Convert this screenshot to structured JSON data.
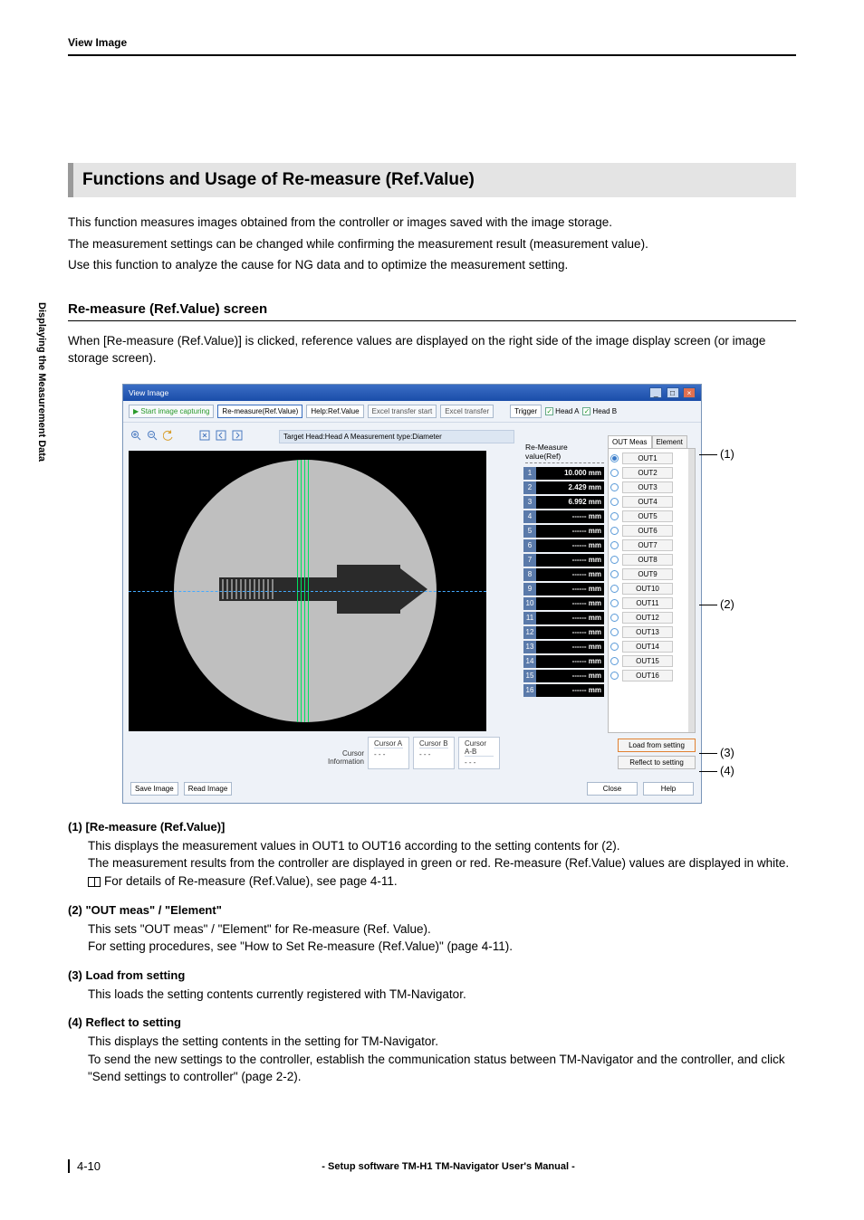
{
  "header": {
    "title": "View Image"
  },
  "sideTab": "Displaying the Measurement Data",
  "section": {
    "title": "Functions and Usage of Re-measure (Ref.Value)"
  },
  "intro": [
    "This function measures images obtained from the controller or images saved with the image storage.",
    "The measurement settings can be changed while confirming the measurement result (measurement value).",
    "Use this function to analyze the cause for NG data and to optimize the measurement setting."
  ],
  "subhead": "Re-measure (Ref.Value) screen",
  "subpara": "When [Re-measure (Ref.Value)] is clicked, reference values are displayed on the right side of the image display screen (or image storage screen).",
  "window": {
    "title": "View Image",
    "toolbar": {
      "start": "Start image capturing",
      "remeasure": "Re-measure(Ref.Value)",
      "help": "Help:Ref.Value",
      "xfer_start": "Excel transfer start",
      "xfer": "Excel transfer",
      "trigger": "Trigger",
      "headA": "Head A",
      "headB": "Head B"
    },
    "infobar": "Target Head:Head A  Measurement type:Diameter",
    "valHeader": "Re-Measure value(Ref)",
    "values": [
      {
        "i": "1",
        "v": "10.000 mm"
      },
      {
        "i": "2",
        "v": "2.429 mm"
      },
      {
        "i": "3",
        "v": "6.992 mm"
      },
      {
        "i": "4",
        "v": "------ mm"
      },
      {
        "i": "5",
        "v": "------ mm"
      },
      {
        "i": "6",
        "v": "------ mm"
      },
      {
        "i": "7",
        "v": "------ mm"
      },
      {
        "i": "8",
        "v": "------ mm"
      },
      {
        "i": "9",
        "v": "------ mm"
      },
      {
        "i": "10",
        "v": "------ mm"
      },
      {
        "i": "11",
        "v": "------ mm"
      },
      {
        "i": "12",
        "v": "------ mm"
      },
      {
        "i": "13",
        "v": "------ mm"
      },
      {
        "i": "14",
        "v": "------ mm"
      },
      {
        "i": "15",
        "v": "------ mm"
      },
      {
        "i": "16",
        "v": "------ mm"
      }
    ],
    "tabs": {
      "a": "OUT Meas",
      "b": "Element"
    },
    "outs": [
      "OUT1",
      "OUT2",
      "OUT3",
      "OUT4",
      "OUT5",
      "OUT6",
      "OUT7",
      "OUT8",
      "OUT9",
      "OUT10",
      "OUT11",
      "OUT12",
      "OUT13",
      "OUT14",
      "OUT15",
      "OUT16"
    ],
    "load": "Load from setting",
    "reflect": "Reflect to setting",
    "cursor": {
      "label": "Cursor\nInformation",
      "a": "Cursor A",
      "b": "Cursor B",
      "ab": "Cursor A-B",
      "dash": "- - -"
    },
    "footer": {
      "save": "Save Image",
      "read": "Read Image",
      "close": "Close",
      "helpb": "Help"
    }
  },
  "callouts": {
    "c1": "(1)",
    "c2": "(2)",
    "c3": "(3)",
    "c4": "(4)"
  },
  "items": [
    {
      "head": "(1) [Re-measure (Ref.Value)]",
      "lines": [
        "This displays the measurement values in OUT1 to OUT16 according to the setting contents for (2).",
        "The measurement results from the controller are displayed in green or red. Re-measure (Ref.Value) values are displayed in white."
      ],
      "ref": "For details of Re-measure (Ref.Value), see page 4-11."
    },
    {
      "head": "(2) \"OUT meas\" / \"Element\"",
      "lines": [
        "This sets \"OUT meas\" / \"Element\" for Re-measure (Ref. Value).",
        "For setting procedures, see \"How to Set Re-measure (Ref.Value)\" (page 4-11)."
      ]
    },
    {
      "head": "(3) Load from setting",
      "lines": [
        "This loads the setting contents currently registered with TM-Navigator."
      ]
    },
    {
      "head": "(4) Reflect to setting",
      "lines": [
        "This displays the setting contents in the setting for TM-Navigator.",
        "To send the new settings to the controller, establish the communication status between TM-Navigator and the controller, and click \"Send settings to controller\" (page 2-2)."
      ]
    }
  ],
  "footer": {
    "page": "4-10",
    "manual": "- Setup software TM-H1 TM-Navigator User's Manual -"
  }
}
